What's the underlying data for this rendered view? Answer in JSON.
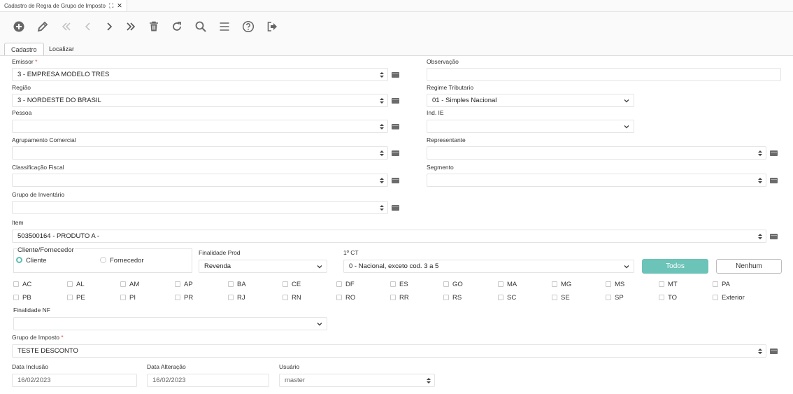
{
  "window": {
    "tab_title": "Cadastro de Regra de Grupo de Imposto"
  },
  "toolbar": {
    "icons": [
      "add-icon",
      "edit-icon",
      "first-icon",
      "previous-icon",
      "next-icon",
      "last-icon",
      "delete-icon",
      "refresh-icon",
      "search-icon",
      "list-icon",
      "help-icon",
      "exit-icon"
    ]
  },
  "tabs": [
    {
      "label": "Cadastro"
    },
    {
      "label": "Localizar"
    }
  ],
  "form": {
    "emissor": {
      "label": "Emissor",
      "required": "*",
      "value": "3 - EMPRESA MODELO TRES"
    },
    "observacao": {
      "label": "Observação",
      "value": ""
    },
    "regiao": {
      "label": "Região",
      "value": "3 - NORDESTE DO BRASIL"
    },
    "regime_tributario": {
      "label": "Regime Tributario",
      "value": "01 - Simples Nacional"
    },
    "pessoa": {
      "label": "Pessoa",
      "value": ""
    },
    "ind_ie": {
      "label": "Ind. IE",
      "value": ""
    },
    "agrupamento_comercial": {
      "label": "Agrupamento Comercial",
      "value": ""
    },
    "representante": {
      "label": "Representante",
      "value": ""
    },
    "classificacao_fiscal": {
      "label": "Classificação Fiscal",
      "value": ""
    },
    "segmento": {
      "label": "Segmento",
      "value": ""
    },
    "grupo_inventario": {
      "label": "Grupo de Inventário",
      "value": ""
    },
    "item": {
      "label": "Item",
      "value": "503500164 - PRODUTO A -"
    },
    "cliente_fornecedor": {
      "legend": "Cliente/Fornecedor",
      "options": [
        {
          "label": "Cliente",
          "selected": true
        },
        {
          "label": "Fornecedor",
          "selected": false
        }
      ]
    },
    "finalidade_prod": {
      "label": "Finalidade Prod",
      "value": "Revenda"
    },
    "primeiro_ct": {
      "label": "1º CT",
      "value": "0 - Nacional, exceto cod. 3 a 5"
    },
    "buttons": {
      "todos": "Todos",
      "nenhum": "Nenhum"
    },
    "estados_row1": [
      "AC",
      "AL",
      "AM",
      "AP",
      "BA",
      "CE",
      "DF",
      "ES",
      "GO",
      "MA",
      "MG",
      "MS",
      "MT",
      "PA"
    ],
    "estados_row2": [
      "PB",
      "PE",
      "PI",
      "PR",
      "RJ",
      "RN",
      "RO",
      "RR",
      "RS",
      "SC",
      "SE",
      "SP",
      "TO",
      "Exterior"
    ],
    "finalidade_nf": {
      "label": "Finalidade NF",
      "value": ""
    },
    "grupo_imposto": {
      "label": "Grupo de Imposto",
      "required": "*",
      "value": "TESTE DESCONTO"
    },
    "data_inclusao": {
      "label": "Data Inclusão",
      "value": "16/02/2023"
    },
    "data_alteracao": {
      "label": "Data Alteração",
      "value": "16/02/2023"
    },
    "usuario": {
      "label": "Usuário",
      "value": "master"
    }
  },
  "colors": {
    "accent": "#6cc3b7",
    "required": "#d9534f",
    "icon": "#666666"
  }
}
